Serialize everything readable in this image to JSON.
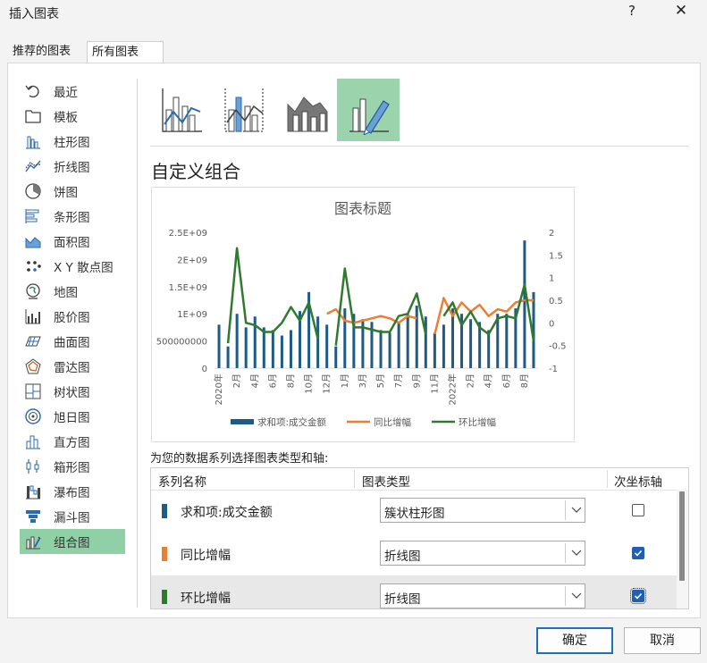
{
  "window": {
    "title": "插入图表",
    "help": "?",
    "close": "✕"
  },
  "tabs": [
    {
      "label": "推荐的图表"
    },
    {
      "label": "所有图表"
    }
  ],
  "sidebar": {
    "items": [
      {
        "label": "最近",
        "icon": "recent-icon"
      },
      {
        "label": "模板",
        "icon": "template-icon"
      },
      {
        "label": "柱形图",
        "icon": "column-chart-icon"
      },
      {
        "label": "折线图",
        "icon": "line-chart-icon"
      },
      {
        "label": "饼图",
        "icon": "pie-chart-icon"
      },
      {
        "label": "条形图",
        "icon": "bar-chart-icon"
      },
      {
        "label": "面积图",
        "icon": "area-chart-icon"
      },
      {
        "label": "X Y 散点图",
        "icon": "scatter-chart-icon"
      },
      {
        "label": "地图",
        "icon": "map-chart-icon"
      },
      {
        "label": "股价图",
        "icon": "stock-chart-icon"
      },
      {
        "label": "曲面图",
        "icon": "surface-chart-icon"
      },
      {
        "label": "雷达图",
        "icon": "radar-chart-icon"
      },
      {
        "label": "树状图",
        "icon": "treemap-chart-icon"
      },
      {
        "label": "旭日图",
        "icon": "sunburst-chart-icon"
      },
      {
        "label": "直方图",
        "icon": "histogram-chart-icon"
      },
      {
        "label": "箱形图",
        "icon": "box-whisker-chart-icon"
      },
      {
        "label": "瀑布图",
        "icon": "waterfall-chart-icon"
      },
      {
        "label": "漏斗图",
        "icon": "funnel-chart-icon"
      },
      {
        "label": "组合图",
        "icon": "combo-chart-icon"
      }
    ],
    "selected": "组合图"
  },
  "main": {
    "heading": "自定义组合",
    "series_section_label": "为您的数据系列选择图表类型和轴:",
    "columns": {
      "name": "系列名称",
      "type": "图表类型",
      "secondary": "次坐标轴"
    },
    "series_rows": [
      {
        "name": "求和项:成交金额",
        "color": "#1f5c85",
        "chart_type": "簇状柱形图",
        "secondary": false
      },
      {
        "name": "同比增幅",
        "color": "#ed7d31",
        "chart_type": "折线图",
        "secondary": true
      },
      {
        "name": "环比增幅",
        "color": "#2f7a2f",
        "chart_type": "折线图",
        "secondary": true
      }
    ]
  },
  "buttons": {
    "ok": "确定",
    "cancel": "取消"
  },
  "chart_data": {
    "type": "combo",
    "title": "图表标题",
    "x": [
      "2020年",
      "2月",
      "3月",
      "4月",
      "5月",
      "6月",
      "7月",
      "8月",
      "9月",
      "10月",
      "11月",
      "12月",
      "1月",
      "2月",
      "3月",
      "4月",
      "5月",
      "6月",
      "7月",
      "8月",
      "9月",
      "10月",
      "11月",
      "12月",
      "2022年",
      "2月",
      "3月",
      "4月",
      "5月",
      "6月",
      "7月",
      "8月",
      "9月",
      "10月",
      "11月",
      "12月"
    ],
    "x_tick_labels": [
      "2020年",
      "2月",
      "4月",
      "6月",
      "8月",
      "10月",
      "12月",
      "1月",
      "3月",
      "5月",
      "7月",
      "9月",
      "11月",
      "2022年",
      "2月",
      "4月",
      "6月",
      "8月",
      "10月",
      "12月"
    ],
    "y_left": {
      "ticks": [
        "0",
        "500000000",
        "1E+09",
        "1.5E+09",
        "2E+09",
        "2.5E+09"
      ],
      "range": [
        0,
        2500000000
      ]
    },
    "y_right": {
      "ticks": [
        "-1",
        "-0.5",
        "0",
        "0.5",
        "1",
        "1.5",
        "2"
      ],
      "range": [
        -1,
        2
      ]
    },
    "series": [
      {
        "name": "求和项:成交金额",
        "kind": "bar",
        "axis": "left",
        "color": "#1f5c85",
        "values": [
          800000000,
          400000000,
          1000000000,
          750000000,
          950000000,
          750000000,
          700000000,
          600000000,
          700000000,
          1050000000,
          1400000000,
          950000000,
          800000000,
          400000000,
          1100000000,
          1000000000,
          900000000,
          850000000,
          700000000,
          650000000,
          850000000,
          1000000000,
          1150000000,
          950000000,
          650000000,
          800000000,
          1100000000,
          1000000000,
          900000000,
          850000000,
          700000000,
          1000000000,
          1000000000,
          1100000000,
          2350000000,
          1400000000
        ]
      },
      {
        "name": "同比增幅",
        "kind": "line",
        "axis": "right",
        "color": "#ed7d31",
        "values": [
          null,
          null,
          null,
          null,
          null,
          null,
          null,
          null,
          null,
          null,
          null,
          null,
          0.2,
          0.3,
          0.05,
          0,
          0.05,
          0.1,
          0.15,
          0.1,
          0,
          0.15,
          0.1,
          null,
          -0.25,
          0.55,
          0.15,
          0.45,
          0.25,
          0.4,
          0.15,
          0.3,
          0.25,
          0.45,
          0.5,
          0.5
        ]
      },
      {
        "name": "环比增幅",
        "kind": "line",
        "axis": "right",
        "color": "#2f7a2f",
        "values": [
          null,
          -0.45,
          1.65,
          0,
          -0.05,
          -0.2,
          -0.2,
          0,
          0.35,
          0.05,
          0.45,
          -0.35,
          null,
          -0.5,
          1.2,
          -0.1,
          -0.1,
          -0.15,
          -0.2,
          -0.2,
          0.15,
          0.2,
          0.65,
          -0.25,
          null,
          0.15,
          0.45,
          -0.05,
          0.25,
          -0.1,
          -0.25,
          0.1,
          0.15,
          0.1,
          0.85,
          -0.4
        ]
      }
    ],
    "legend_position": "bottom",
    "grid": false
  }
}
